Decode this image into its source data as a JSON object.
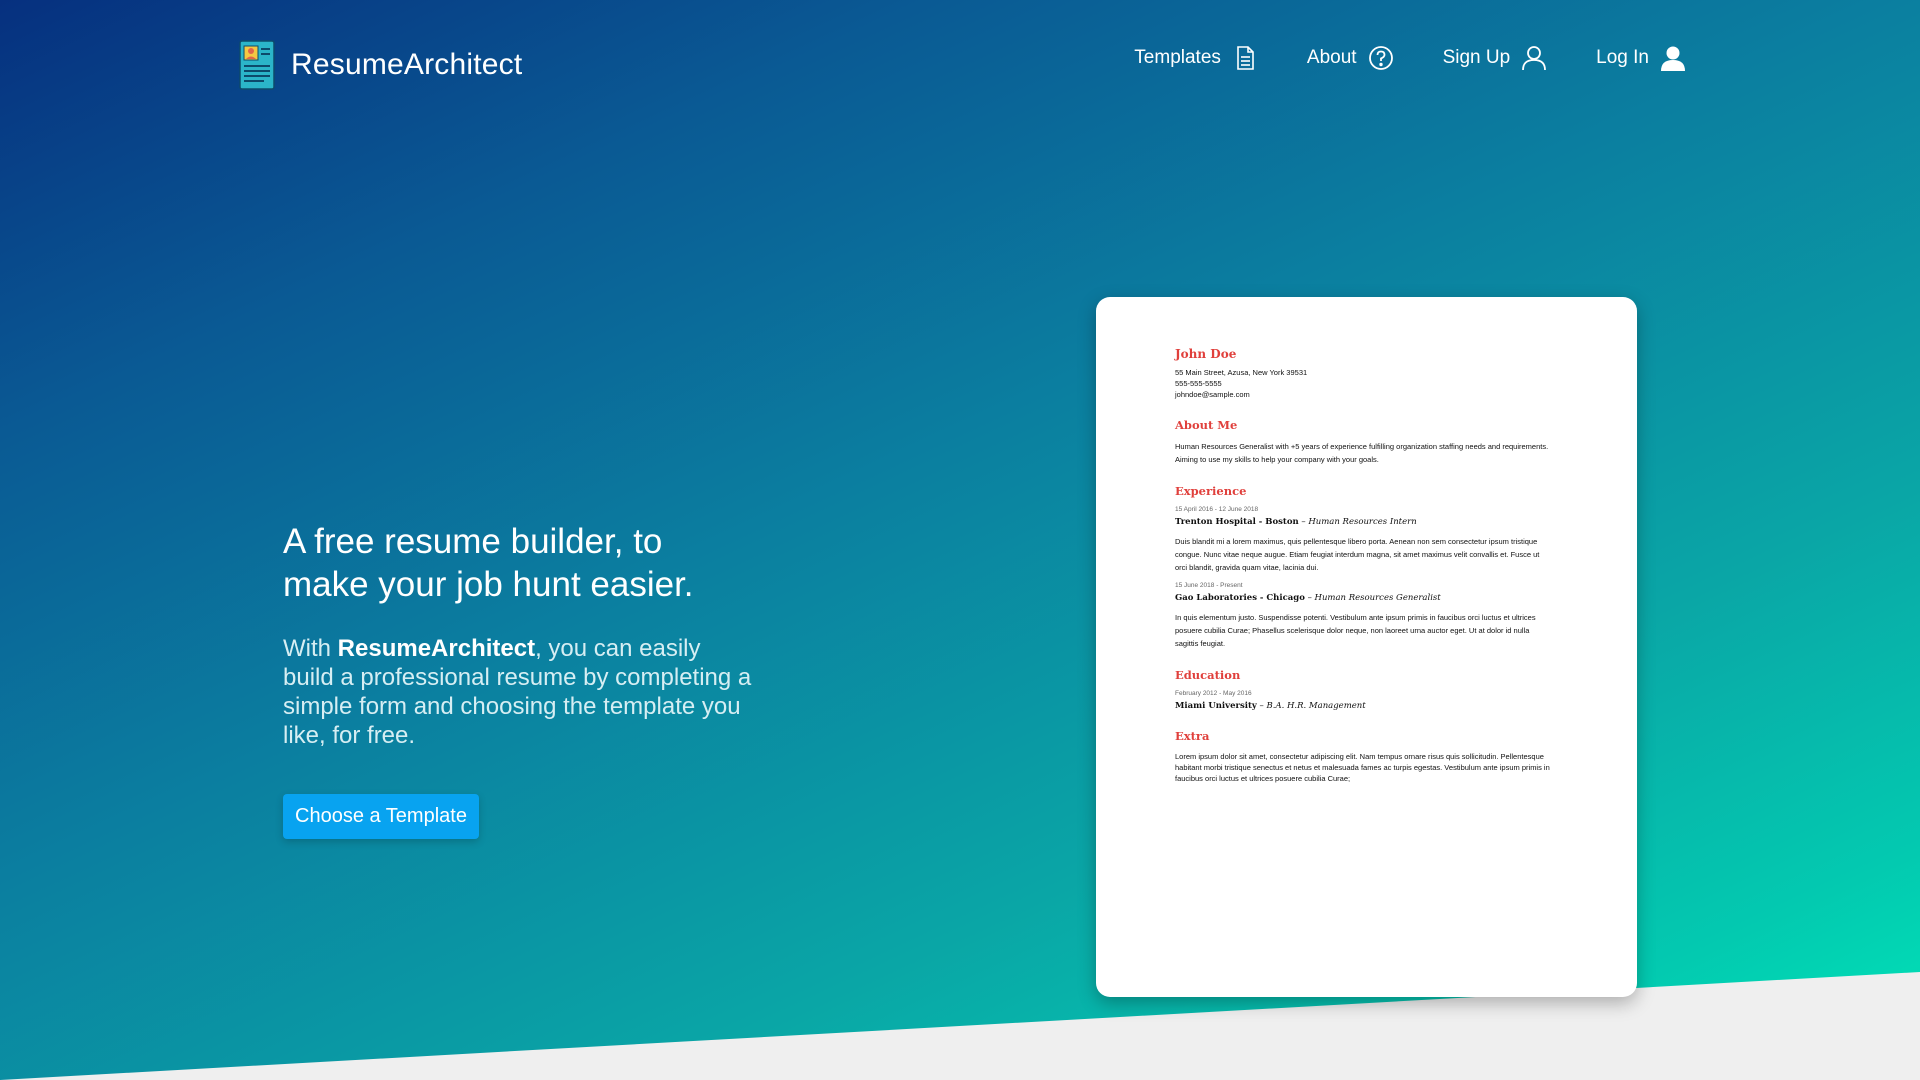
{
  "brand": {
    "name": "ResumeArchitect"
  },
  "nav": {
    "templates": "Templates",
    "about": "About",
    "signup": "Sign Up",
    "login": "Log In"
  },
  "hero": {
    "headline": "A free resume builder, to make your job hunt easier.",
    "desc_prefix": "With ",
    "desc_brand": "ResumeArchitect",
    "desc_suffix": ", you can easily build a professional resume by completing a simple form and choosing the template you like, for free.",
    "cta": "Choose a Template"
  },
  "resume": {
    "name": "John Doe",
    "address": "55 Main Street, Azusa, New York 39531",
    "phone": "555-555-5555",
    "email": "johndoe@sample.com",
    "about_title": "About Me",
    "about_text": "Human Resources Generalist with +5 years of experience fulfilling organization staffing needs and requirements. Aiming to use my skills to help your company with your goals.",
    "experience_title": "Experience",
    "jobs": [
      {
        "dates": "15 April 2016 - 12 June 2018",
        "company": "Trenton Hospital - Boston",
        "role": "Human Resources Intern",
        "text": "Duis blandit mi a lorem maximus, quis pellentesque libero porta. Aenean non sem consectetur ipsum tristique congue. Nunc vitae neque augue. Etiam feugiat interdum magna, sit amet maximus velit convallis et. Fusce ut orci blandit, gravida quam vitae, lacinia dui."
      },
      {
        "dates": "15 June 2018 - Present",
        "company": "Gao Laboratories - Chicago",
        "role": "Human Resources Generalist",
        "text": "In quis elementum justo. Suspendisse potenti. Vestibulum ante ipsum primis in faucibus orci luctus et ultrices posuere cubilia Curae; Phasellus scelerisque dolor neque, non laoreet urna auctor eget. Ut at dolor id nulla sagittis feugiat."
      }
    ],
    "education_title": "Education",
    "edu_dates": "February 2012 - May 2016",
    "edu_school": "Miami University",
    "edu_degree": "B.A. H.R. Management",
    "extra_title": "Extra",
    "extra_text": "Lorem ipsum dolor sit amet, consectetur adipiscing elit. Nam tempus ornare risus quis sollicitudin. Pellentesque habitant morbi tristique senectus et netus et malesuada fames ac turpis egestas. Vestibulum ante ipsum primis in faucibus orci luctus et ultrices posuere cubilia Curae;"
  }
}
